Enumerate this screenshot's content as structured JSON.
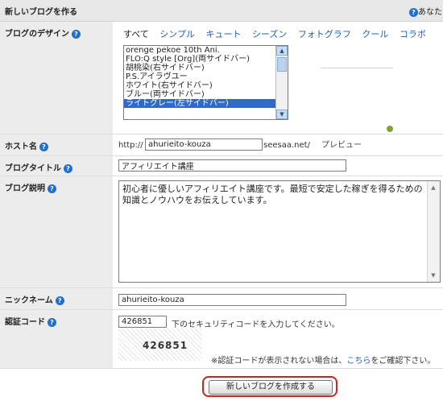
{
  "header": {
    "title": "新しいブログを作る",
    "right_text": "あなたの"
  },
  "design": {
    "label": "ブログのデザイン",
    "categories": [
      "すべて",
      "シンプル",
      "キュート",
      "シーズン",
      "フォトグラフ",
      "クール",
      "コラボ"
    ],
    "templates": [
      "orenge pekoe 10th Ani.",
      "FLO:Q style [Org](両サイドバー)",
      "胡桃染(右サイドバー)",
      "P.S.アイラヴユー",
      "ホワイト(右サイドバー)",
      "ブルー(両サイドバー)",
      "ライトグレー(左サイドバー)"
    ],
    "selected_template": "ライトグレー(左サイドバー)",
    "preview_label": "プレビュー"
  },
  "host": {
    "label": "ホスト名",
    "prefix": "http://",
    "value": "ahurieito-kouza",
    "suffix": "seesaa.net/"
  },
  "blog_title": {
    "label": "ブログタイトル",
    "value": "アフィリエイト講座"
  },
  "blog_description": {
    "label": "ブログ説明",
    "value": "初心者に優しいアフィリエイト講座です。最短で安定した稼ぎを得るための知識とノウハウをお伝えしています。"
  },
  "nickname": {
    "label": "ニックネーム",
    "value": "ahurieito-kouza"
  },
  "captcha": {
    "label": "認証コード",
    "value": "426851",
    "instruction": "下のセキュリティコードを入力してください。",
    "image_text": "426851",
    "note_prefix": "※認証コードが表示されない場合は、",
    "note_link": "こちら",
    "note_suffix": "をご確認下さい。"
  },
  "submit": {
    "label": "新しいブログを作成する"
  },
  "colors": {
    "highlight": "#d41f1f",
    "link": "#1f5fb8",
    "selection": "#3169c6"
  }
}
